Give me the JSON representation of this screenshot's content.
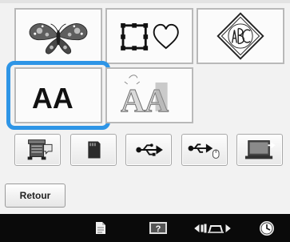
{
  "pattern_categories": {
    "row1": [
      {
        "icon": "butterfly-embroidery-icon"
      },
      {
        "icon": "square-heart-frame-icon"
      },
      {
        "icon": "abc-monogram-icon"
      }
    ],
    "row2": [
      {
        "icon": "alphabet-font-icon",
        "text": "AA",
        "selected": true
      },
      {
        "icon": "decorative-alphabet-icon",
        "text": "AA"
      }
    ]
  },
  "memory_sources": [
    {
      "icon": "machine-memory-icon"
    },
    {
      "icon": "sd-card-icon"
    },
    {
      "icon": "usb-icon"
    },
    {
      "icon": "usb-mouse-icon"
    },
    {
      "icon": "computer-icon"
    }
  ],
  "buttons": {
    "back_label": "Retour"
  },
  "taskbar": [
    {
      "icon": "document-icon"
    },
    {
      "icon": "help-icon"
    },
    {
      "icon": "presser-foot-icon"
    },
    {
      "icon": "clock-icon"
    }
  ],
  "colors": {
    "selection": "#2e95e6",
    "taskbar": "#0a0a0a"
  }
}
